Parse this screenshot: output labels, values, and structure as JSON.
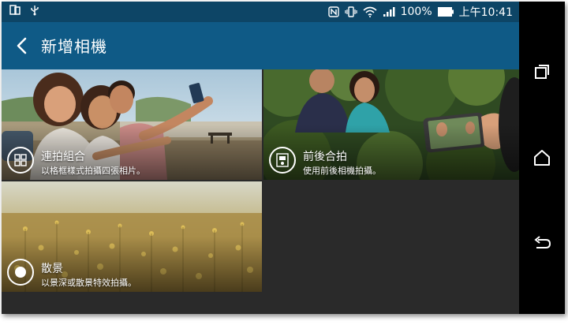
{
  "status_bar": {
    "battery_percent": "100%",
    "time": "上午10:41",
    "icons": [
      "dual-sim-icon",
      "usb-icon",
      "nfc-icon",
      "vibrate-icon",
      "wifi-icon",
      "signal-icon",
      "battery-icon"
    ]
  },
  "app_bar": {
    "title": "新增相機",
    "back_icon": "back-arrow-icon"
  },
  "modes": [
    {
      "title": "連拍組合",
      "description": "以格框樣式拍攝四張相片。",
      "icon": "photo-grid-icon"
    },
    {
      "title": "前後合拍",
      "description": "使用前後相機拍攝。",
      "icon": "split-camera-icon"
    },
    {
      "title": "散景",
      "description": "以景深或散景特效拍攝。",
      "icon": "bokeh-icon"
    }
  ],
  "nav_bar": {
    "icons": [
      "recent-apps-icon",
      "home-icon",
      "back-icon"
    ]
  },
  "colors": {
    "status_bar": "#0d4566",
    "app_bar": "#0f5a86",
    "screen_bg": "#2a2a2a"
  }
}
